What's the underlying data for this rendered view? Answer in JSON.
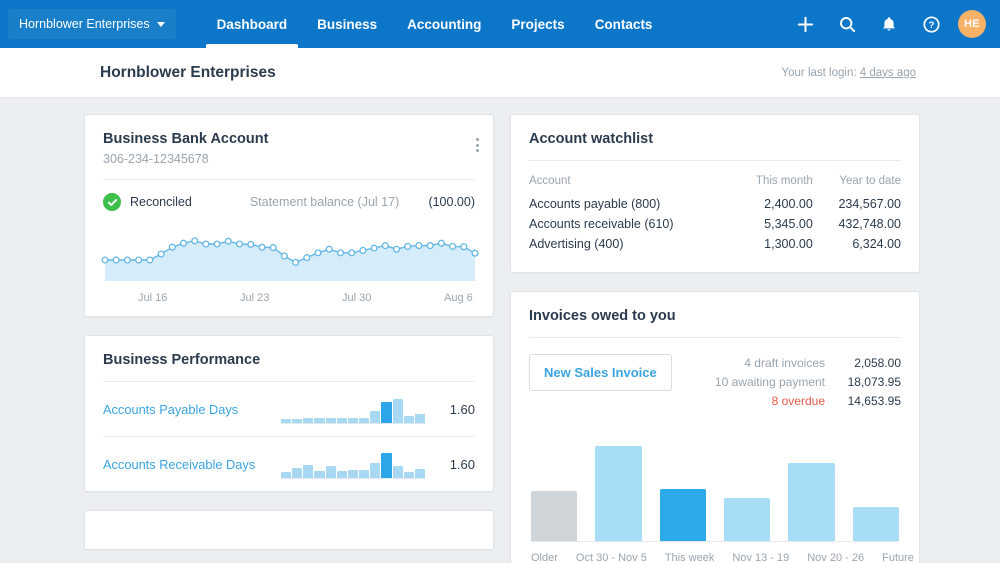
{
  "navbar": {
    "org_name": "Hornblower Enterprises",
    "org_caret_icon": "chevron-down-icon",
    "links": [
      {
        "label": "Dashboard",
        "active": true
      },
      {
        "label": "Business",
        "active": false
      },
      {
        "label": "Accounting",
        "active": false
      },
      {
        "label": "Projects",
        "active": false
      },
      {
        "label": "Contacts",
        "active": false
      }
    ],
    "icons": [
      "plus-icon",
      "search-icon",
      "bell-icon",
      "help-icon"
    ],
    "avatar_initials": "HE",
    "avatar_color": "#f7b267",
    "background_color": "#0c76c9"
  },
  "subheader": {
    "title": "Hornblower Enterprises",
    "last_login_label": "Your last login: ",
    "last_login_value": "4 days ago"
  },
  "bank_card": {
    "title": "Business Bank Account",
    "account_number": "306-234-12345678",
    "menu_icon": "kebab-menu-icon",
    "status_icon": "check-circle-icon",
    "status_label": "Reconciled",
    "statement_label": "Statement balance (Jul 17)",
    "statement_amount": "(100.00)"
  },
  "performance_card": {
    "title": "Business Performance",
    "rows": [
      {
        "label": "Accounts Payable Days",
        "value": "1.60"
      },
      {
        "label": "Accounts Receivable Days",
        "value": "1.60"
      }
    ]
  },
  "watchlist_card": {
    "title": "Account watchlist",
    "columns": [
      "Account",
      "This month",
      "Year to date"
    ],
    "rows": [
      {
        "account": "Accounts payable (800)",
        "this_month": "2,400.00",
        "ytd": "234,567.00"
      },
      {
        "account": "Accounts receivable (610)",
        "this_month": "5,345.00",
        "ytd": "432,748.00"
      },
      {
        "account": "Advertising (400)",
        "this_month": "1,300.00",
        "ytd": "6,324.00"
      }
    ]
  },
  "invoices_card": {
    "title": "Invoices owed to you",
    "new_invoice_button": "New Sales Invoice",
    "stats": [
      {
        "label": "4 draft invoices",
        "amount": "2,058.00",
        "overdue": false
      },
      {
        "label": "10 awaiting payment",
        "amount": "18,073.95",
        "overdue": false
      },
      {
        "label": "8 overdue",
        "amount": "14,653.95",
        "overdue": true
      }
    ]
  },
  "chart_data": [
    {
      "type": "line",
      "name": "bank-balance-sparkline",
      "title": "Business Bank Account balance",
      "xlabel": "",
      "ylabel": "",
      "grid": false,
      "legend": null,
      "tick_labels": [
        "Jul 16",
        "Jul 23",
        "Jul 30",
        "Aug 6"
      ],
      "tick_positions_pct": [
        13,
        38,
        63,
        88
      ],
      "values": [
        30,
        30,
        30,
        30,
        30,
        45,
        62,
        72,
        78,
        70,
        70,
        77,
        70,
        69,
        62,
        61,
        40,
        24,
        36,
        48,
        57,
        48,
        48,
        54,
        60,
        66,
        57,
        64,
        66,
        66,
        72,
        64,
        63,
        47
      ],
      "ylim": [
        0,
        100
      ],
      "line_color": "#63b7e5",
      "fill_color": "#d5ecfa",
      "marker": "circle-open"
    },
    {
      "type": "bar",
      "name": "accounts-payable-days-sparkbar",
      "title": "Accounts Payable Days",
      "categories": [
        "1",
        "2",
        "3",
        "4",
        "5",
        "6",
        "7",
        "8",
        "9",
        "10",
        "11",
        "12"
      ],
      "values": [
        18,
        18,
        20,
        20,
        20,
        20,
        20,
        20,
        42,
        72,
        82,
        26,
        34
      ],
      "highlight_index": 9,
      "bar_color": "#a8d8f2",
      "highlight_color": "#2ca6e8",
      "ylim": [
        0,
        100
      ]
    },
    {
      "type": "bar",
      "name": "accounts-receivable-days-sparkbar",
      "title": "Accounts Receivable Days",
      "categories": [
        "1",
        "2",
        "3",
        "4",
        "5",
        "6",
        "7",
        "8",
        "9",
        "10",
        "11",
        "12"
      ],
      "values": [
        24,
        36,
        47,
        26,
        42,
        27,
        30,
        30,
        52,
        88,
        45,
        25,
        33
      ],
      "highlight_index": 9,
      "bar_color": "#a8d8f2",
      "highlight_color": "#2ca6e8",
      "ylim": [
        0,
        100
      ]
    },
    {
      "type": "bar",
      "name": "invoices-owed-bar-chart",
      "title": "Invoices owed to you",
      "categories": [
        "Older",
        "Oct 30 - Nov 5",
        "This week",
        "Nov 13 - 19",
        "Nov 20 - 26",
        "Future"
      ],
      "values": [
        47,
        90,
        49,
        41,
        74,
        32
      ],
      "colors": [
        "#cfd4d9",
        "#a8ddf8",
        "#2ca9e8",
        "#a8ddf8",
        "#a8ddf8",
        "#a8ddf8"
      ],
      "highlight_index": 2,
      "ylim": [
        0,
        100
      ],
      "grid": false,
      "xlabel": "",
      "ylabel": ""
    }
  ]
}
